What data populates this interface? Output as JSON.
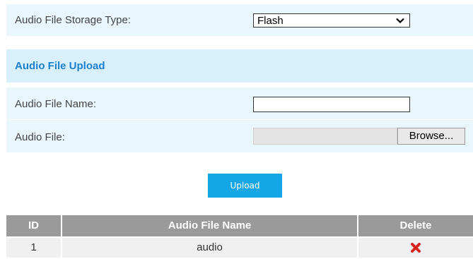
{
  "storage": {
    "label": "Audio File Storage Type:",
    "selected": "Flash"
  },
  "upload_section": {
    "title": "Audio File Upload"
  },
  "file_name": {
    "label": "Audio File Name:",
    "value": ""
  },
  "audio_file": {
    "label": "Audio File:",
    "browse_label": "Browse..."
  },
  "upload_button": {
    "label": "Upload"
  },
  "table": {
    "headers": [
      "ID",
      "Audio File Name",
      "Delete"
    ],
    "rows": [
      {
        "id": "1",
        "name": "audio",
        "delete_icon": "delete-x-icon"
      }
    ]
  },
  "colors": {
    "accent": "#14a6e6",
    "section_title": "#1b7fd0",
    "section_background": "#d8f0fc",
    "row_background": "#eaf6fd",
    "table_header": "#9a9a9a",
    "delete_icon": "#d6241c"
  }
}
